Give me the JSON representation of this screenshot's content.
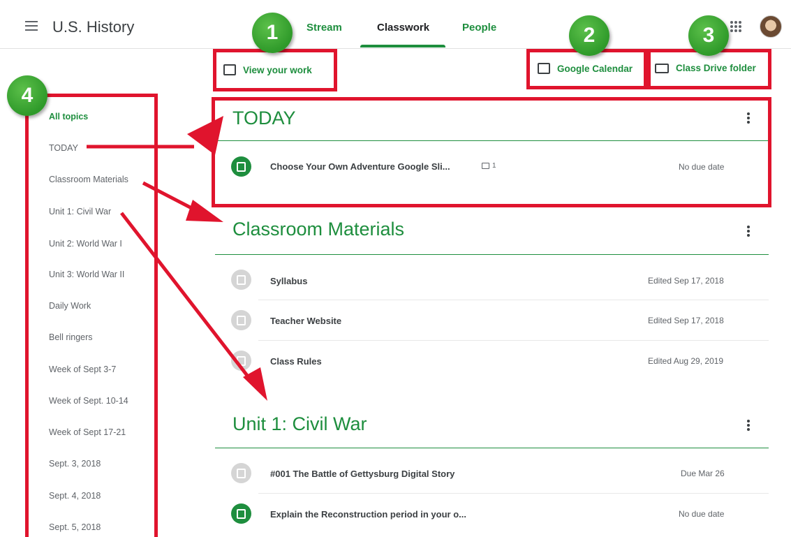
{
  "header": {
    "app_title": "U.S. History",
    "tabs": [
      {
        "label": "Stream"
      },
      {
        "label": "Classwork"
      },
      {
        "label": "People"
      }
    ]
  },
  "toolbar": {
    "view_work": "View your work",
    "calendar": "Google Calendar",
    "drive": "Class Drive folder"
  },
  "sidebar": {
    "topics": [
      "All topics",
      "TODAY",
      "Classroom Materials",
      "Unit 1: Civil War",
      "Unit 2: World War I",
      "Unit 3: World War II",
      "Daily Work",
      "Bell ringers",
      "Week of Sept 3-7",
      "Week of Sept. 10-14",
      "Week of Sept 17-21",
      "Sept. 3, 2018",
      "Sept. 4, 2018",
      "Sept. 5, 2018"
    ]
  },
  "sections": {
    "today": {
      "title": "TODAY",
      "items": [
        {
          "title": "Choose Your Own Adventure Google Sli...",
          "comments": "1",
          "meta": "No due date"
        }
      ]
    },
    "materials": {
      "title": "Classroom Materials",
      "items": [
        {
          "title": "Syllabus",
          "meta": "Edited Sep 17, 2018"
        },
        {
          "title": "Teacher Website",
          "meta": "Edited Sep 17, 2018"
        },
        {
          "title": "Class Rules",
          "meta": "Edited Aug 29, 2019"
        }
      ]
    },
    "unit1": {
      "title": "Unit 1: Civil War",
      "items": [
        {
          "title": "#001 The Battle of Gettysburg Digital Story",
          "meta": "Due Mar 26"
        },
        {
          "title": "Explain the Reconstruction period in your o...",
          "meta": "No due date"
        }
      ]
    }
  },
  "annotations": {
    "badges": [
      "1",
      "2",
      "3",
      "4"
    ]
  },
  "colors": {
    "accent": "#1e8e3e",
    "annotation_red": "#e0142d",
    "badge_green": "#3aa635"
  }
}
